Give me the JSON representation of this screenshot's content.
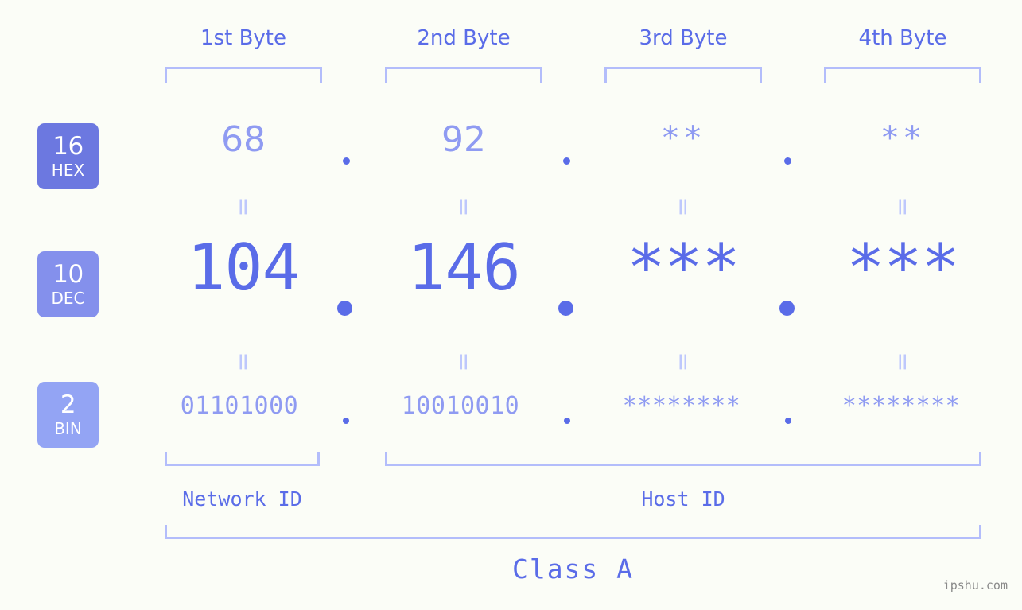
{
  "page": {
    "background_color": "#fbfdf7",
    "accent_color": "#5a6ce8",
    "accent_light_color": "#8f9bf2",
    "bracket_color": "#b3bdfb",
    "watermark": "ipshu.com"
  },
  "headers": [
    {
      "label": "1st Byte"
    },
    {
      "label": "2nd Byte"
    },
    {
      "label": "3rd Byte"
    },
    {
      "label": "4th Byte"
    }
  ],
  "bases": [
    {
      "num": "16",
      "abbr": "HEX",
      "color": "#6c78e0"
    },
    {
      "num": "10",
      "abbr": "DEC",
      "color": "#8490ec"
    },
    {
      "num": "2",
      "abbr": "BIN",
      "color": "#93a4f4"
    }
  ],
  "rows": {
    "hex": {
      "values": [
        "68",
        "92",
        "**",
        "**"
      ],
      "separator": "."
    },
    "dec": {
      "values": [
        "104",
        "146",
        "***",
        "***"
      ],
      "separator": "."
    },
    "bin": {
      "values": [
        "01101000",
        "10010010",
        "********",
        "********"
      ],
      "separator": "."
    }
  },
  "equality_marks": [
    "=",
    "=",
    "=",
    "="
  ],
  "sections": [
    {
      "label": "Network ID"
    },
    {
      "label": "Host ID"
    }
  ],
  "class": {
    "label": "Class A"
  }
}
